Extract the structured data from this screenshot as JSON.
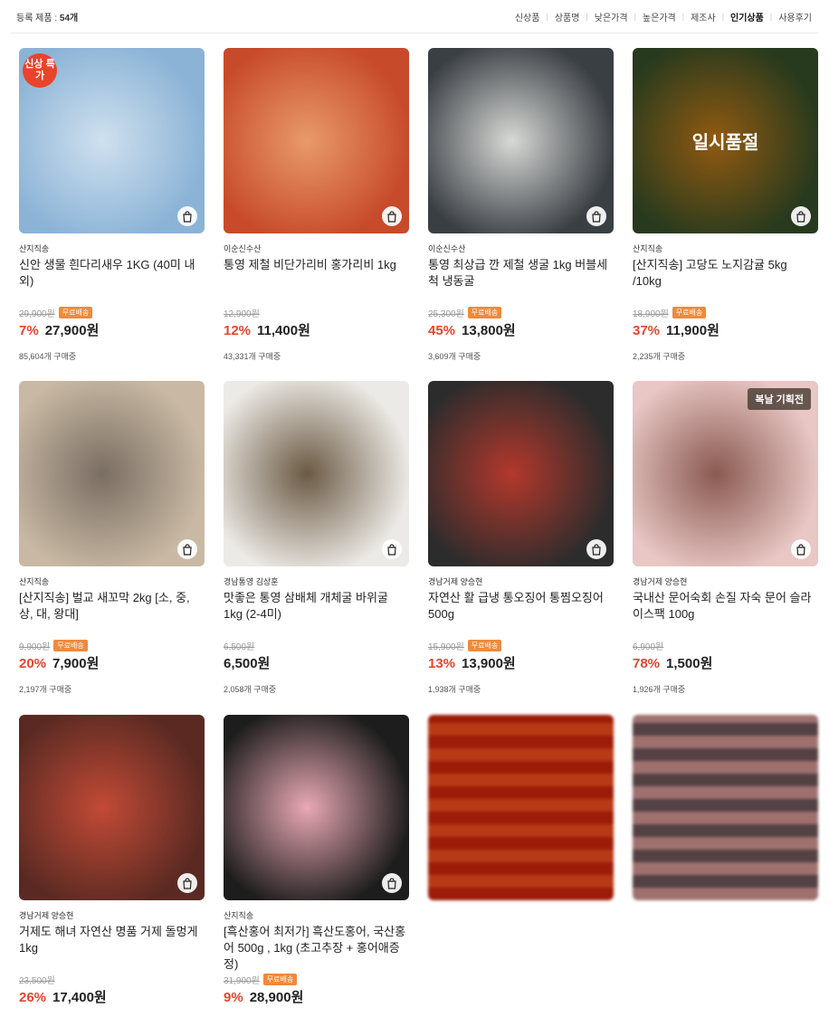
{
  "header": {
    "count_label": "등록 제품 :",
    "count_value": "54개",
    "sorts": [
      "신상품",
      "상품명",
      "낮은가격",
      "높은가격",
      "제조사",
      "인기상품",
      "사용후기"
    ],
    "active_sort": "인기상품"
  },
  "cart_icon": "shopping-bag-icon",
  "free_shipping_label": "무료배송",
  "products": [
    {
      "seller": "산지직송",
      "name": "신안 생물 흰다리새우 1KG (40미 내외)",
      "old_price": "29,900원",
      "free": true,
      "discount": "7%",
      "price": "27,900원",
      "buyers": "85,604개 구매중",
      "badge": "신상\n특가",
      "colors": [
        "#8bb3d6",
        "#cfe0ee"
      ]
    },
    {
      "seller": "이순신수산",
      "name": "통영 제철 비단가리비 홍가리비 1kg",
      "old_price": "12,900원",
      "free": false,
      "discount": "12%",
      "price": "11,400원",
      "buyers": "43,331개 구매중",
      "colors": [
        "#c74a2a",
        "#e89a6a"
      ]
    },
    {
      "seller": "이순신수산",
      "name": "통영 최상급 깐 제철 생굴 1kg 버블세척 냉동굴",
      "old_price": "25,300원",
      "free": true,
      "discount": "45%",
      "price": "13,800원",
      "buyers": "3,609개 구매중",
      "colors": [
        "#3a3f44",
        "#d8d9d6"
      ]
    },
    {
      "seller": "산지직송",
      "name": "[산지직송] 고당도 노지감귤 5kg /10kg",
      "old_price": "18,900원",
      "free": true,
      "discount": "37%",
      "price": "11,900원",
      "buyers": "2,235개 구매중",
      "soldout": "일시품절",
      "colors": [
        "#3e5a2e",
        "#e08a1a"
      ]
    },
    {
      "seller": "산지직송",
      "name": "[산지직송] 벌교 새꼬막 2kg [소, 중, 상, 대, 왕대]",
      "old_price": "9,900원",
      "free": true,
      "discount": "20%",
      "price": "7,900원",
      "buyers": "2,197개 구매중",
      "colors": [
        "#c9b9a4",
        "#7a6e63"
      ]
    },
    {
      "seller": "경남통영 김상훈",
      "name": "맛좋은 통영 삼배체 개체굴 바위굴 1kg (2-4미)",
      "old_price": "6,500원",
      "free": false,
      "discount": "",
      "price": "6,500원",
      "buyers": "2,058개 구매중",
      "colors": [
        "#eceae6",
        "#6b5a44"
      ]
    },
    {
      "seller": "경남거제 양승현",
      "name": "자연산 활 급냉 통오징어 통찜오징어 500g",
      "old_price": "15,900원",
      "free": true,
      "discount": "13%",
      "price": "13,900원",
      "buyers": "1,938개 구매중",
      "colors": [
        "#2c2c2c",
        "#b4382c"
      ]
    },
    {
      "seller": "경남거제 양승현",
      "name": "국내산 문어숙회 손질 자숙 문어 슬라이스팩 100g",
      "old_price": "6,900원",
      "free": false,
      "discount": "78%",
      "price": "1,500원",
      "buyers": "1,926개 구매중",
      "badge_rect": "복날 기획전",
      "colors": [
        "#e8c7c4",
        "#8a5a52"
      ]
    },
    {
      "seller": "경남거제 양승현",
      "name": "거제도 해녀 자연산 명품 거제 돌멍게 1kg",
      "old_price": "23,500원",
      "free": false,
      "discount": "26%",
      "price": "17,400원",
      "buyers": "",
      "colors": [
        "#5a2a22",
        "#c24a36"
      ]
    },
    {
      "seller": "산지직송",
      "name": "[흑산홍어 최저가] 흑산도홍어, 국산홍어 500g , 1kg (초고추장 + 홍어애증정)",
      "old_price": "31,900원",
      "free": true,
      "discount": "9%",
      "price": "28,900원",
      "buyers": "",
      "colors": [
        "#1d1d1d",
        "#e9a8b4"
      ]
    },
    {
      "seller": "",
      "name": "",
      "old_price": "",
      "free": false,
      "discount": "",
      "price": "",
      "buyers": "",
      "blurred": true,
      "colors": [
        "#c8542c",
        "#e8b07a"
      ]
    },
    {
      "seller": "",
      "name": "",
      "old_price": "",
      "free": false,
      "discount": "",
      "price": "",
      "buyers": "",
      "blurred": true,
      "colors": [
        "#c9aaa8",
        "#6b6266"
      ]
    }
  ]
}
